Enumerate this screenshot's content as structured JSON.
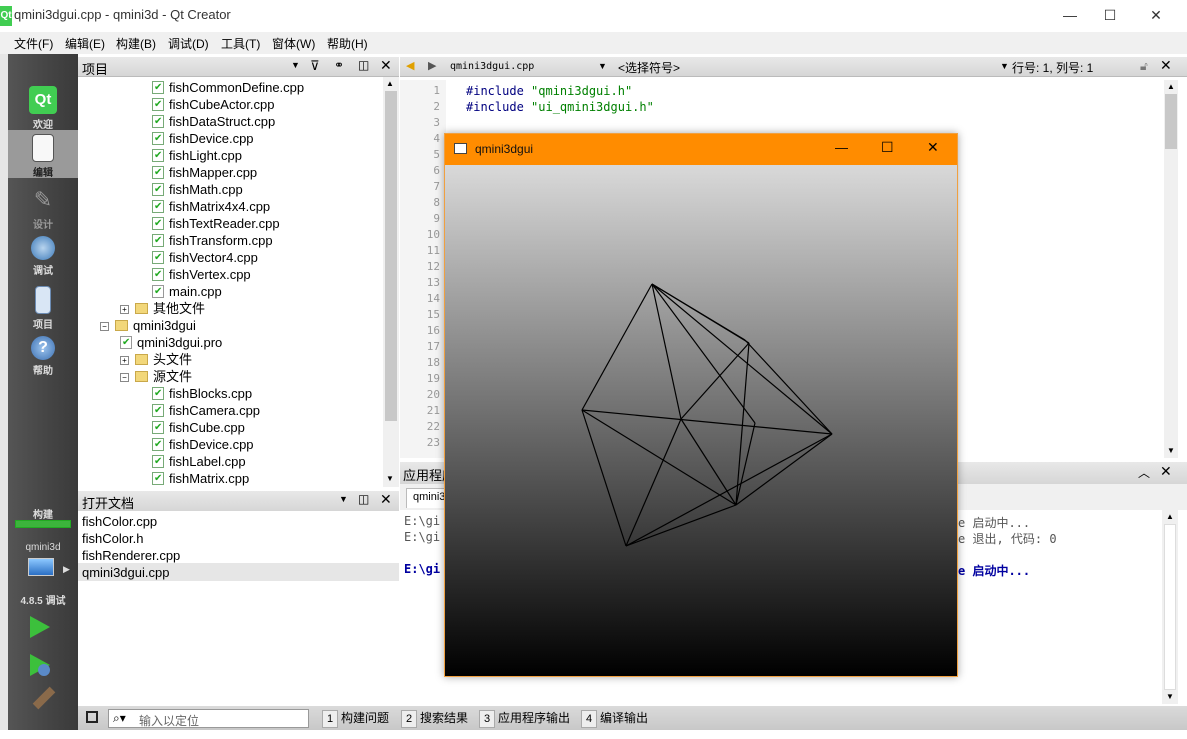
{
  "window": {
    "title": "qmini3dgui.cpp - qmini3d - Qt Creator",
    "minimize": "—",
    "maximize": "☐",
    "close": "✕",
    "app_icon": "Qt"
  },
  "menu": [
    "文件(F)",
    "编辑(E)",
    "构建(B)",
    "调试(D)",
    "工具(T)",
    "窗体(W)",
    "帮助(H)"
  ],
  "modes": [
    {
      "label": "欢迎",
      "icon": "qt-logo-icon"
    },
    {
      "label": "编辑",
      "icon": "edit-document-icon"
    },
    {
      "label": "设计",
      "icon": "design-tools-icon"
    },
    {
      "label": "调试",
      "icon": "debug-icon"
    },
    {
      "label": "项目",
      "icon": "project-icon"
    },
    {
      "label": "帮助",
      "icon": "help-icon"
    }
  ],
  "kit": {
    "build_label": "构建",
    "project": "qmini3d",
    "config": "4.8.5 调试"
  },
  "projects_pane": {
    "title": "项目",
    "tree": [
      {
        "indent": 3,
        "kind": "file",
        "label": "fishCommonDefine.cpp"
      },
      {
        "indent": 3,
        "kind": "file",
        "label": "fishCubeActor.cpp"
      },
      {
        "indent": 3,
        "kind": "file",
        "label": "fishDataStruct.cpp"
      },
      {
        "indent": 3,
        "kind": "file",
        "label": "fishDevice.cpp"
      },
      {
        "indent": 3,
        "kind": "file",
        "label": "fishLight.cpp"
      },
      {
        "indent": 3,
        "kind": "file",
        "label": "fishMapper.cpp"
      },
      {
        "indent": 3,
        "kind": "file",
        "label": "fishMath.cpp"
      },
      {
        "indent": 3,
        "kind": "file",
        "label": "fishMatrix4x4.cpp"
      },
      {
        "indent": 3,
        "kind": "file",
        "label": "fishTextReader.cpp"
      },
      {
        "indent": 3,
        "kind": "file",
        "label": "fishTransform.cpp"
      },
      {
        "indent": 3,
        "kind": "file",
        "label": "fishVector4.cpp"
      },
      {
        "indent": 3,
        "kind": "file",
        "label": "fishVertex.cpp"
      },
      {
        "indent": 3,
        "kind": "plain",
        "label": "main.cpp"
      },
      {
        "indent": 2,
        "kind": "folder",
        "toggle": "+",
        "label": "其他文件"
      },
      {
        "indent": 1,
        "kind": "folder",
        "toggle": "−",
        "label": "qmini3dgui"
      },
      {
        "indent": 2,
        "kind": "plain",
        "label": "qmini3dgui.pro"
      },
      {
        "indent": 2,
        "kind": "folder",
        "toggle": "+",
        "label": "头文件"
      },
      {
        "indent": 2,
        "kind": "folder",
        "toggle": "−",
        "label": "源文件"
      },
      {
        "indent": 3,
        "kind": "file",
        "label": "fishBlocks.cpp"
      },
      {
        "indent": 3,
        "kind": "file",
        "label": "fishCamera.cpp"
      },
      {
        "indent": 3,
        "kind": "file",
        "label": "fishCube.cpp"
      },
      {
        "indent": 3,
        "kind": "file",
        "label": "fishDevice.cpp"
      },
      {
        "indent": 3,
        "kind": "file",
        "label": "fishLabel.cpp"
      },
      {
        "indent": 3,
        "kind": "file",
        "label": "fishMatrix.cpp"
      }
    ]
  },
  "open_docs": {
    "title": "打开文档",
    "items": [
      "fishColor.cpp",
      "fishColor.h",
      "fishRenderer.cpp",
      "qmini3dgui.cpp"
    ],
    "selected": 3
  },
  "editor": {
    "file_combo": "qmini3dgui.cpp",
    "symbol_combo": "<选择符号>",
    "position": "行号: 1, 列号: 1",
    "line_numbers": [
      "1",
      "2",
      "3",
      "4",
      "5",
      "6",
      "7",
      "8",
      "9",
      "10",
      "11",
      "12",
      "13",
      "14",
      "15",
      "16",
      "17",
      "18",
      "19",
      "20",
      "21",
      "22",
      "23"
    ],
    "code": [
      {
        "kw": "#include",
        "str": "\"qmini3dgui.h\""
      },
      {
        "kw": "#include",
        "str": "\"ui_qmini3dgui.h\""
      }
    ]
  },
  "output": {
    "title": "应用程序",
    "tab": "qmini3",
    "lines_left": [
      "E:\\gi",
      "E:\\gi",
      "",
      "E:\\gi"
    ],
    "lines_right": [
      "e 启动中...",
      "e 退出, 代码: 0",
      "",
      "e 启动中..."
    ]
  },
  "statusbar": {
    "locator_placeholder": "输入以定位",
    "tabs": [
      {
        "num": "1",
        "label": "构建问题"
      },
      {
        "num": "2",
        "label": "搜索结果"
      },
      {
        "num": "3",
        "label": "应用程序输出"
      },
      {
        "num": "4",
        "label": "编译输出"
      }
    ]
  },
  "app_window": {
    "title": "qmini3dgui",
    "minimize": "—",
    "maximize": "☐",
    "close": "✕"
  }
}
